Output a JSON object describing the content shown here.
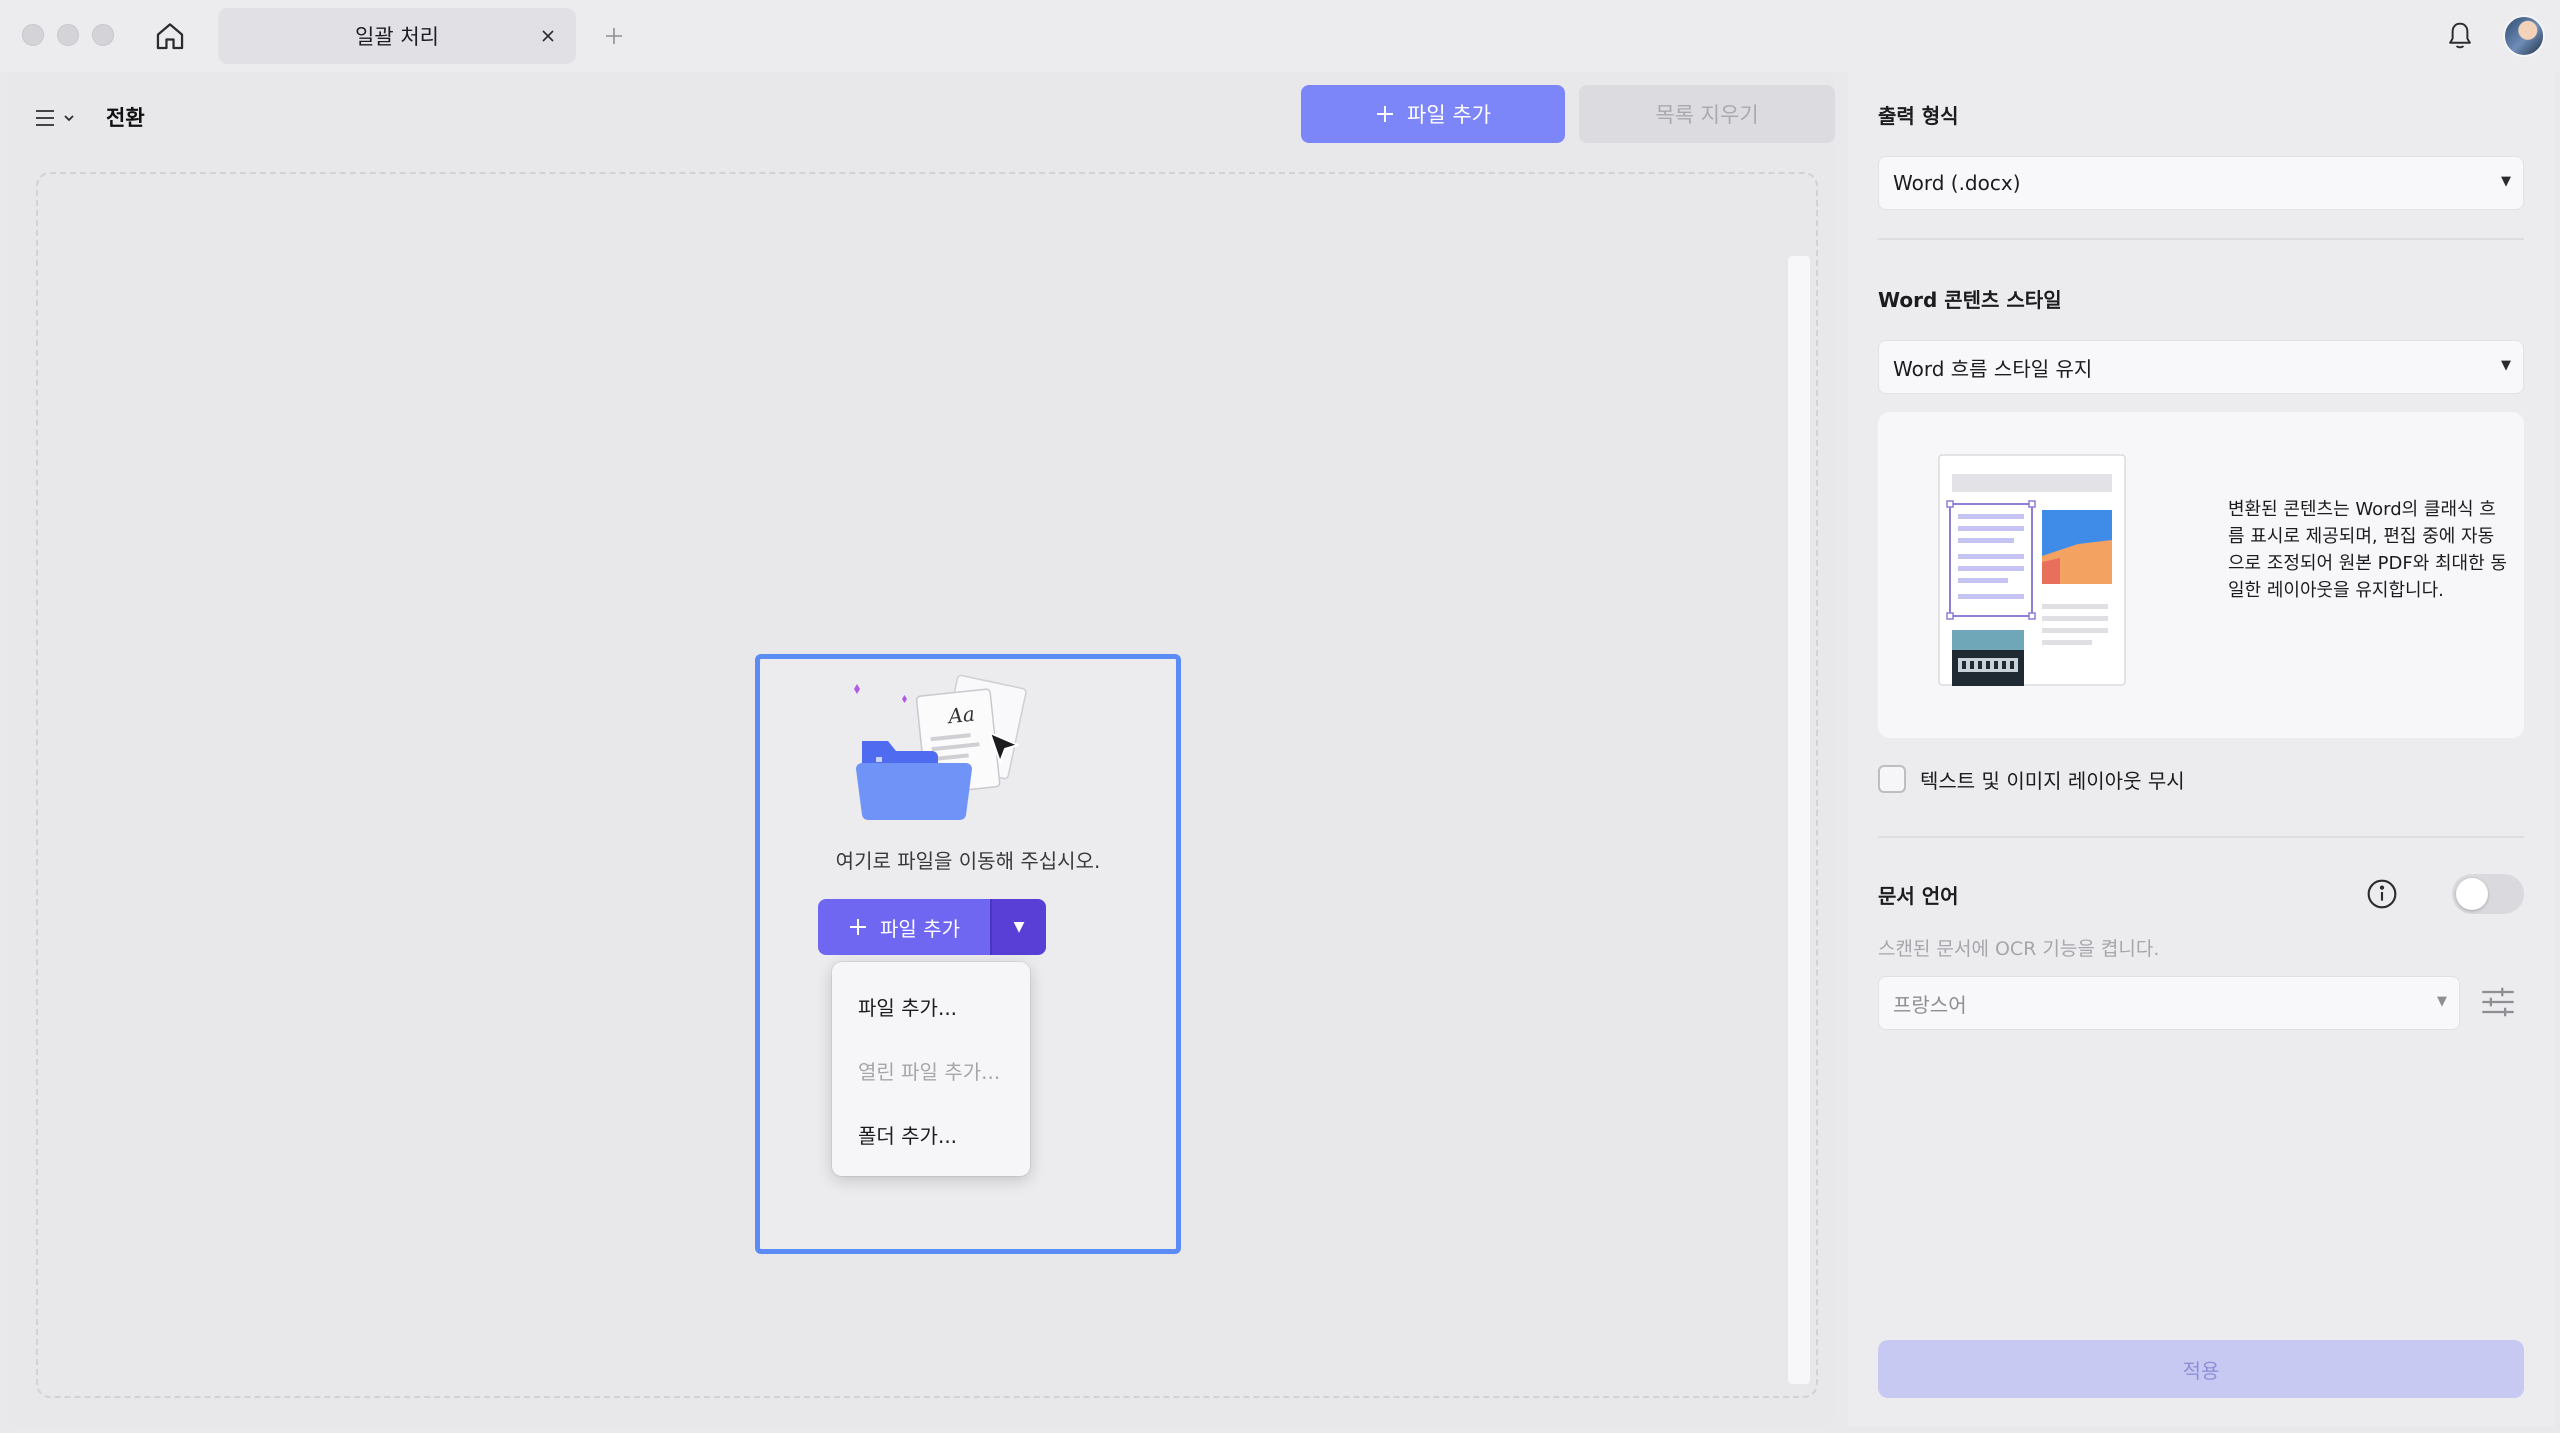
{
  "titlebar": {
    "tab_label": "일괄 처리"
  },
  "header": {
    "title": "전환",
    "add_file_label": "파일 추가",
    "clear_list_label": "목록 지우기"
  },
  "dropzone": {
    "hint": "여기로 파일을 이동해 주십시오.",
    "add_button_label": "파일 추가",
    "menu": [
      {
        "label": "파일 추가...",
        "enabled": true
      },
      {
        "label": "열린 파일 추가...",
        "enabled": false
      },
      {
        "label": "폴더 추가...",
        "enabled": true
      }
    ]
  },
  "settings": {
    "output_format_title": "출력 형식",
    "output_format_value": "Word (.docx)",
    "content_style_title": "Word 콘텐츠 스타일",
    "content_style_value": "Word 흐름 스타일 유지",
    "preview_description": "변환된 콘텐츠는 Word의 클래식 흐름 표시로 제공되며, 편집 중에 자동으로 조정되어 원본 PDF와 최대한 동일한 레이아웃을 유지합니다.",
    "ignore_layout_label": "텍스트 및 이미지 레이아웃 무시",
    "ignore_layout_checked": false,
    "doc_language_title": "문서 언어",
    "ocr_enabled": false,
    "ocr_description": "스캔된 문서에 OCR 기능을 켭니다.",
    "language_value": "프랑스어",
    "apply_label": "적용"
  },
  "colors": {
    "primary": "#7c86f8",
    "split_main": "#6f66f2",
    "split_arrow": "#5a3fd7",
    "drop_border": "#5b8cf5",
    "apply_disabled": "#c8c9f3"
  }
}
